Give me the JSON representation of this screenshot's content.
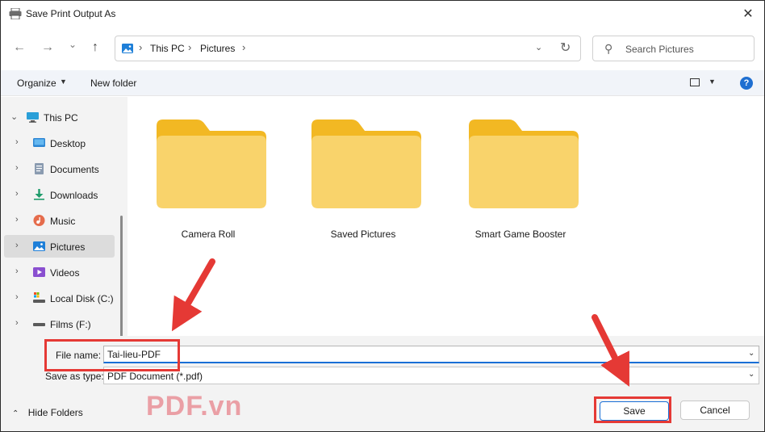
{
  "window": {
    "title": "Save Print Output As",
    "close_glyph": "✕"
  },
  "nav": {
    "back_glyph": "←",
    "forward_glyph": "→",
    "recent_glyph": "⌄",
    "up_glyph": "↑",
    "breadcrumb": [
      "This PC",
      "Pictures"
    ],
    "crumb_sep": "›",
    "dropdown_glyph": "⌄",
    "refresh_glyph": "↻"
  },
  "search": {
    "placeholder": "Search Pictures",
    "icon_glyph": "⚲"
  },
  "toolbar": {
    "organize_label": "Organize",
    "caret_glyph": "▼",
    "new_folder_label": "New folder",
    "help_glyph": "?"
  },
  "sidebar": {
    "root": {
      "label": "This PC",
      "icon": "monitor-icon",
      "chevron": "⌄"
    },
    "items": [
      {
        "label": "Desktop",
        "icon": "desktop-icon",
        "chevron": "›"
      },
      {
        "label": "Documents",
        "icon": "documents-icon",
        "chevron": "›"
      },
      {
        "label": "Downloads",
        "icon": "download-icon",
        "chevron": "›"
      },
      {
        "label": "Music",
        "icon": "music-icon",
        "chevron": "›"
      },
      {
        "label": "Pictures",
        "icon": "pictures-icon",
        "chevron": "›",
        "selected": true
      },
      {
        "label": "Videos",
        "icon": "videos-icon",
        "chevron": "›"
      },
      {
        "label": "Local Disk (C:)",
        "icon": "local-disk-icon",
        "chevron": "›"
      },
      {
        "label": "Films (F:)",
        "icon": "drive-icon",
        "chevron": "›"
      }
    ]
  },
  "folders": [
    {
      "name": "Camera Roll"
    },
    {
      "name": "Saved Pictures"
    },
    {
      "name": "Smart Game Booster"
    }
  ],
  "file_name": {
    "label": "File name:",
    "value": "Tai-lieu-PDF"
  },
  "save_as_type": {
    "label": "Save as type:",
    "value": "PDF Document (*.pdf)"
  },
  "footer": {
    "hide_folders_label": "Hide Folders",
    "hide_folders_glyph": "⌃",
    "watermark": "PDF.vn",
    "save_label": "Save",
    "cancel_label": "Cancel"
  },
  "colors": {
    "accent": "#1a6fd6",
    "annotation": "#e53935",
    "folder_front": "#f9d36b",
    "folder_back": "#f2b823"
  }
}
